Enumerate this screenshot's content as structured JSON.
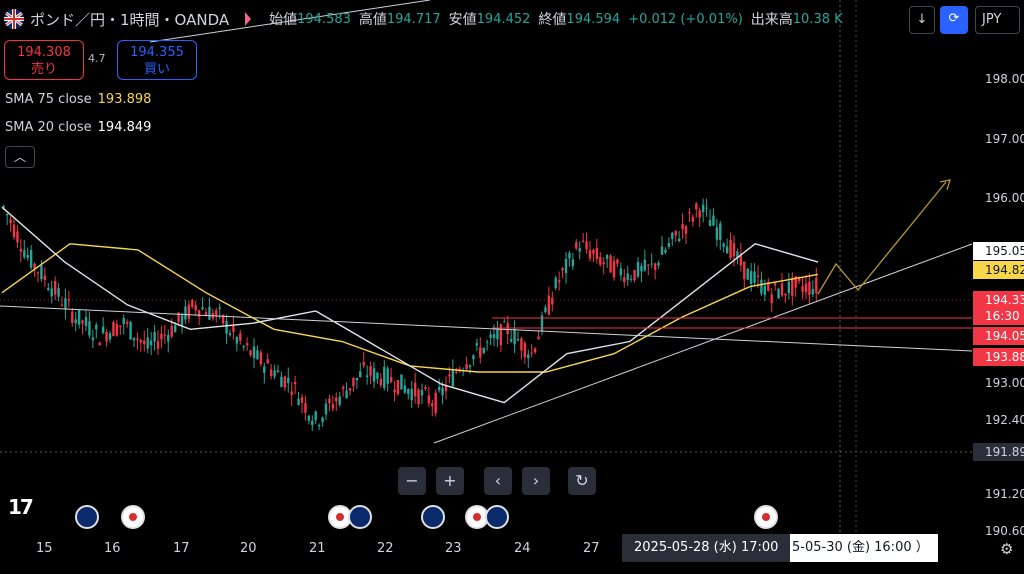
{
  "header": {
    "symbol": "ポンド／円・1時間・OANDA",
    "open_label": "始値",
    "open": "194.583",
    "high_label": "高値",
    "high": "194.717",
    "low_label": "安値",
    "low": "194.452",
    "close_label": "終値",
    "close": "194.594",
    "change": "+0.012 (+0.01%)",
    "volume_label": "出来高",
    "volume": "10.38 K"
  },
  "trade": {
    "sell_price": "194.308",
    "sell_label": "売り",
    "spread": "4.7",
    "buy_price": "194.355",
    "buy_label": "買い"
  },
  "indicators": [
    {
      "label": "SMA 75 close",
      "value": "193.898"
    },
    {
      "label": "SMA 20 close",
      "value": "194.849"
    }
  ],
  "collapse_glyph": "︿",
  "toolbar": {
    "down_glyph": "↓",
    "cycle_glyph": "⟳",
    "currency": "JPY"
  },
  "colors": {
    "up": "#26a69a",
    "down": "#f23645",
    "sma75": "#f7d64b",
    "sma20": "#e0e3eb",
    "accent": "#2962ff",
    "projection": "#b8962e"
  },
  "price_axis": {
    "ticks": [
      "198.00",
      "197.00",
      "196.00",
      "193.00",
      "192.40",
      "191.20",
      "190.60"
    ],
    "tags": [
      {
        "text": "195.05",
        "bg": "#ffffff",
        "fg": "#131722"
      },
      {
        "text": "194.82",
        "bg": "#f7d64b",
        "fg": "#131722"
      },
      {
        "text": "194.33",
        "bg": "#f23645",
        "fg": "#ffffff"
      },
      {
        "text": "16:30",
        "bg": "#f23645",
        "fg": "#ffffff"
      },
      {
        "text": "194.05",
        "bg": "#f23645",
        "fg": "#ffffff"
      },
      {
        "text": "193.88",
        "bg": "#f23645",
        "fg": "#ffffff"
      },
      {
        "text": "191.89",
        "bg": "#2a2e39",
        "fg": "#d1d4dc"
      }
    ]
  },
  "nav": {
    "zoom_out": "−",
    "zoom_in": "+",
    "prev": "‹",
    "next": "›",
    "reset": "↻"
  },
  "logo": "17",
  "time_axis": {
    "labels": [
      "15",
      "16",
      "17",
      "20",
      "21",
      "22",
      "23",
      "24",
      "27"
    ],
    "selected": "2025-05-28 (水)   17:00",
    "crosshair": "5-05-30 (金)   16:00  ）"
  },
  "events": [
    {
      "type": "gb"
    },
    {
      "type": "jp"
    },
    {
      "type": "jp"
    },
    {
      "type": "gb"
    },
    {
      "type": "gb"
    },
    {
      "type": "jp"
    },
    {
      "type": "gb"
    },
    {
      "type": "jp"
    }
  ],
  "chart_data": {
    "type": "candlestick",
    "symbol": "GBPJPY",
    "timeframe": "1h",
    "ylim": [
      190.6,
      198.2
    ],
    "x": [
      "15",
      "16",
      "17",
      "20",
      "21",
      "22",
      "23",
      "24",
      "27"
    ],
    "series": [
      {
        "name": "SMA 75 close",
        "values": [
          194.5,
          195.3,
          195.2,
          194.5,
          193.9,
          193.7,
          193.3,
          193.2,
          193.2,
          193.5,
          194.1,
          194.6,
          194.8
        ]
      },
      {
        "name": "SMA 20 close",
        "values": [
          195.9,
          195.0,
          194.3,
          193.9,
          194.0,
          194.2,
          193.6,
          193.0,
          192.7,
          193.5,
          193.7,
          194.5,
          195.3,
          195.0
        ]
      }
    ],
    "ohlc_sampled": [
      [
        196.1,
        196.3,
        195.5,
        195.9
      ],
      [
        195.9,
        196.0,
        194.9,
        195.1
      ],
      [
        195.1,
        195.4,
        194.3,
        194.6
      ],
      [
        194.6,
        194.9,
        193.8,
        194.1
      ],
      [
        194.1,
        194.5,
        193.6,
        193.8
      ],
      [
        193.8,
        194.2,
        193.5,
        194.0
      ],
      [
        194.0,
        194.3,
        193.4,
        193.6
      ],
      [
        193.6,
        194.1,
        193.3,
        193.9
      ],
      [
        193.9,
        194.5,
        193.7,
        194.3
      ],
      [
        194.3,
        194.6,
        193.8,
        194.1
      ],
      [
        194.1,
        194.3,
        193.4,
        193.6
      ],
      [
        193.6,
        193.9,
        193.0,
        193.3
      ],
      [
        193.3,
        193.6,
        192.7,
        193.0
      ],
      [
        193.0,
        193.2,
        192.1,
        192.4
      ],
      [
        192.4,
        193.0,
        192.2,
        192.8
      ],
      [
        192.8,
        193.4,
        192.6,
        193.2
      ],
      [
        193.2,
        193.6,
        192.9,
        193.1
      ],
      [
        193.1,
        193.4,
        192.3,
        192.9
      ],
      [
        192.9,
        193.2,
        192.3,
        192.7
      ],
      [
        192.7,
        193.5,
        192.5,
        193.3
      ],
      [
        193.3,
        193.8,
        193.1,
        193.6
      ],
      [
        193.6,
        194.2,
        193.4,
        193.9
      ],
      [
        193.9,
        194.3,
        193.2,
        193.5
      ],
      [
        193.5,
        194.9,
        193.2,
        194.6
      ],
      [
        194.6,
        195.6,
        194.3,
        195.3
      ],
      [
        195.3,
        195.6,
        194.8,
        195.0
      ],
      [
        195.0,
        195.4,
        194.6,
        194.8
      ],
      [
        194.8,
        195.2,
        194.5,
        194.9
      ],
      [
        194.9,
        195.6,
        194.7,
        195.4
      ],
      [
        195.4,
        196.3,
        195.0,
        195.9
      ],
      [
        195.9,
        196.2,
        195.3,
        195.4
      ],
      [
        195.4,
        195.6,
        194.6,
        194.8
      ],
      [
        194.8,
        194.9,
        194.3,
        194.5
      ],
      [
        194.5,
        194.7,
        194.3,
        194.6
      ]
    ],
    "lines": [
      "rising support",
      "descending support",
      "horizontal levels 194.05 / 193.88",
      "projection path"
    ],
    "grid": false
  }
}
